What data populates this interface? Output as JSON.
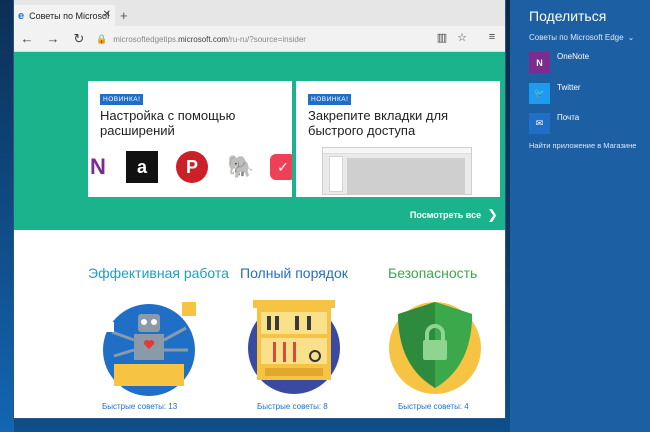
{
  "browser": {
    "tab_title": "Советы по Microsoft Ec",
    "tab_close": "✕",
    "new_tab": "+",
    "url_prefix": "microsoftedgetips.",
    "url_host": "microsoft.com",
    "url_suffix": "/ru-ru/?source=insider"
  },
  "hero": {
    "card1": {
      "badge": "НОВИНКА!",
      "title": "Настройка с помощью расширений"
    },
    "card2": {
      "badge": "НОВИНКА!",
      "title": "Закрепите вкладки для быстрого доступа"
    },
    "see_all": "Посмотреть все"
  },
  "sections": [
    {
      "title": "Эффективная работа",
      "tips": "Быстрые советы: 13"
    },
    {
      "title": "Полный порядок",
      "tips": "Быстрые советы: 8"
    },
    {
      "title": "Безопасность",
      "tips": "Быстрые советы: 4"
    }
  ],
  "share": {
    "title": "Поделиться",
    "subtitle": "Советы по Microsoft Edge",
    "apps": [
      {
        "label": "OneNote",
        "color": "#7b2d8f"
      },
      {
        "label": "Twitter",
        "color": "#1d9bf0"
      },
      {
        "label": "Почта",
        "color": "#1f6fc7"
      }
    ],
    "store_link": "Найти приложение в Магазине"
  },
  "colors": {
    "accent_teal": "#1ab38b",
    "badge_blue": "#1f6fc7",
    "share_bg": "#1d5fa3"
  }
}
